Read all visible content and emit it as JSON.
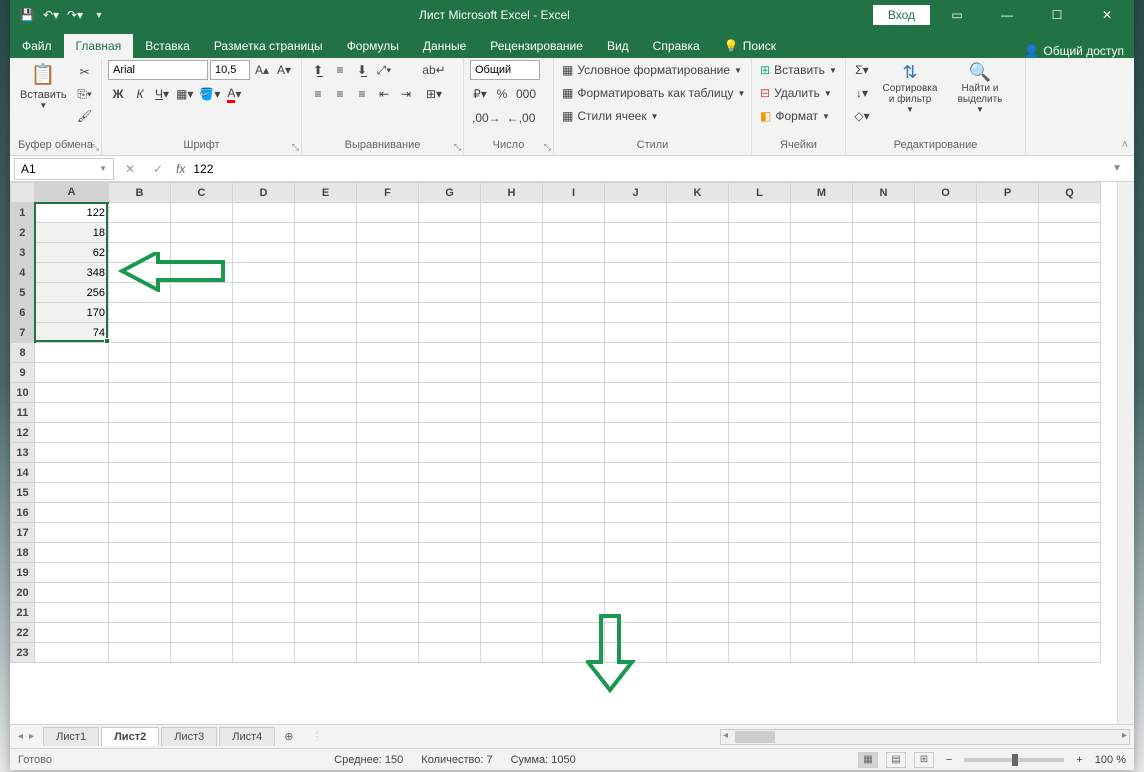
{
  "title": "Лист Microsoft Excel  -  Excel",
  "login": "Вход",
  "tabs": {
    "file": "Файл",
    "home": "Главная",
    "insert": "Вставка",
    "layout": "Разметка страницы",
    "formulas": "Формулы",
    "data": "Данные",
    "review": "Рецензирование",
    "view": "Вид",
    "help": "Справка",
    "search": "Поиск",
    "share": "Общий доступ"
  },
  "ribbon": {
    "clipboard": {
      "paste": "Вставить",
      "label": "Буфер обмена"
    },
    "font": {
      "name": "Arial",
      "size": "10,5",
      "label": "Шрифт"
    },
    "align": {
      "label": "Выравнивание"
    },
    "number": {
      "format": "Общий",
      "label": "Число"
    },
    "styles": {
      "cond": "Условное форматирование",
      "table": "Форматировать как таблицу",
      "cell": "Стили ячеек",
      "label": "Стили"
    },
    "cells": {
      "insert": "Вставить",
      "delete": "Удалить",
      "format": "Формат",
      "label": "Ячейки"
    },
    "editing": {
      "sort": "Сортировка и фильтр",
      "find": "Найти и выделить",
      "label": "Редактирование"
    }
  },
  "namebox": "A1",
  "formula": "122",
  "columns": [
    "A",
    "B",
    "C",
    "D",
    "E",
    "F",
    "G",
    "H",
    "I",
    "J",
    "K",
    "L",
    "M",
    "N",
    "O",
    "P",
    "Q"
  ],
  "rows": [
    "1",
    "2",
    "3",
    "4",
    "5",
    "6",
    "7",
    "8",
    "9",
    "10",
    "11",
    "12",
    "13",
    "14",
    "15",
    "16",
    "17",
    "18",
    "19",
    "20",
    "21",
    "22",
    "23"
  ],
  "cells": {
    "A1": "122",
    "A2": "18",
    "A3": "62",
    "A4": "348",
    "A5": "256",
    "A6": "170",
    "A7": "74"
  },
  "sheets": {
    "s1": "Лист1",
    "s2": "Лист2",
    "s3": "Лист3",
    "s4": "Лист4"
  },
  "status": {
    "ready": "Готово",
    "avg": "Среднее: 150",
    "count": "Количество: 7",
    "sum": "Сумма: 1050",
    "zoom": "100 %"
  }
}
